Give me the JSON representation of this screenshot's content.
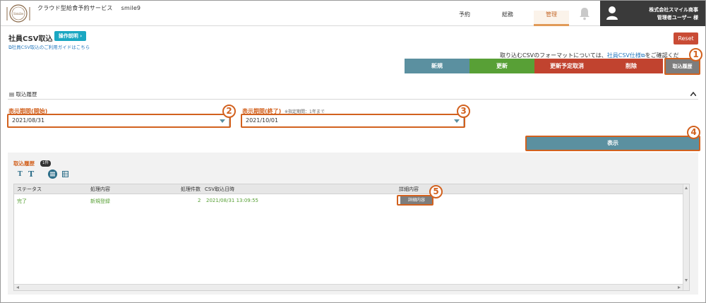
{
  "header": {
    "app_title": "クラウド型給食予約サービス",
    "app_user": "smile9",
    "nav": [
      {
        "label": "予約"
      },
      {
        "label": "総務"
      },
      {
        "label": "管理"
      }
    ],
    "company": "株式会社スマイル商事",
    "username": "管理者ユーザー 様"
  },
  "page": {
    "title": "社員CSV取込",
    "help_label": "操作説明 ›",
    "guide_link": "社員CSV取込のご利用ガイドはこちら",
    "reset_label": "Reset",
    "format_note_before": "取り込むCSVのフォーマットについては、",
    "format_link": "社員CSV仕様",
    "format_note_after": "をご確認くだ"
  },
  "actions": {
    "new": "新規",
    "update": "更新",
    "cancel_scheduled": "更新予定取消",
    "delete": "削除",
    "history": "取込履歴"
  },
  "markers": [
    "1",
    "2",
    "3",
    "4",
    "5"
  ],
  "search": {
    "section_title": "取込履歴",
    "start_label": "表示期間(開始)",
    "end_label": "表示期間(終了)",
    "end_note": "※指定期間：1年まで",
    "start_value": "2021/08/31",
    "end_value": "2021/10/01",
    "show_label": "表示"
  },
  "results": {
    "title": "取込履歴",
    "count": "1件",
    "font_small": "T",
    "font_large": "T",
    "columns": [
      "ステータス",
      "処理内容",
      "処理件数",
      "CSV取込日時",
      "詳細内容"
    ],
    "rows": [
      {
        "status": "完了",
        "process": "新規登録",
        "count": "2",
        "datetime": "2021/08/31 13:09:55",
        "detail_label": "詳細内容"
      }
    ]
  },
  "colors": {
    "accent": "#d2611e",
    "teal": "#5b90a0",
    "green": "#58a036",
    "red": "#c1432f"
  }
}
